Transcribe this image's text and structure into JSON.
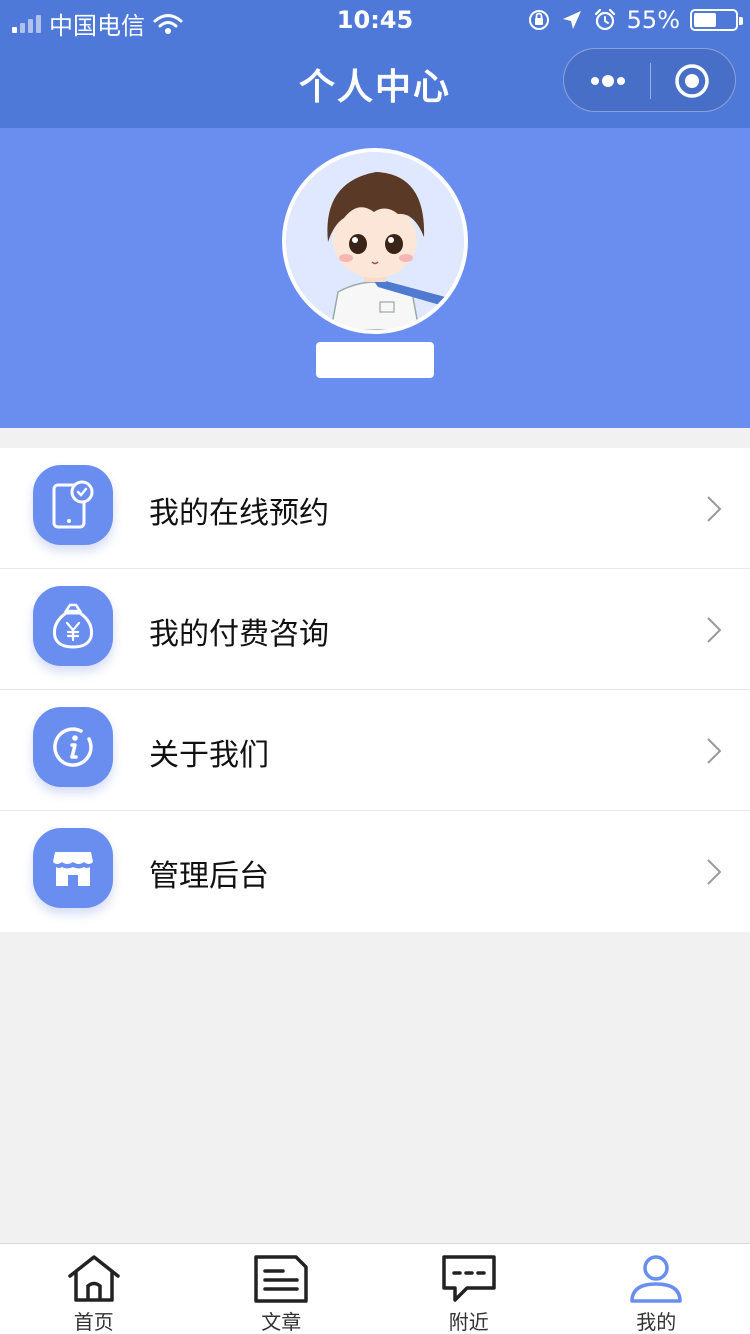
{
  "status_bar": {
    "carrier": "中国电信",
    "time": "10:45",
    "battery_percent": "55%",
    "battery_level": 0.55
  },
  "nav": {
    "title": "个人中心"
  },
  "menu": {
    "items": [
      {
        "label": "我的在线预约",
        "icon": "phone-clock-icon"
      },
      {
        "label": "我的付费咨询",
        "icon": "money-bag-icon"
      },
      {
        "label": "关于我们",
        "icon": "info-icon"
      },
      {
        "label": "管理后台",
        "icon": "store-icon"
      }
    ]
  },
  "tabbar": {
    "items": [
      {
        "label": "首页",
        "icon": "home-icon"
      },
      {
        "label": "文章",
        "icon": "document-icon"
      },
      {
        "label": "附近",
        "icon": "chat-icon"
      },
      {
        "label": "我的",
        "icon": "user-icon"
      }
    ],
    "active_index": 3
  },
  "colors": {
    "nav_bg": "#4f79d8",
    "hero_bg": "#6a8df0",
    "accent": "#6a8df0",
    "page_bg": "#f1f1f1"
  }
}
